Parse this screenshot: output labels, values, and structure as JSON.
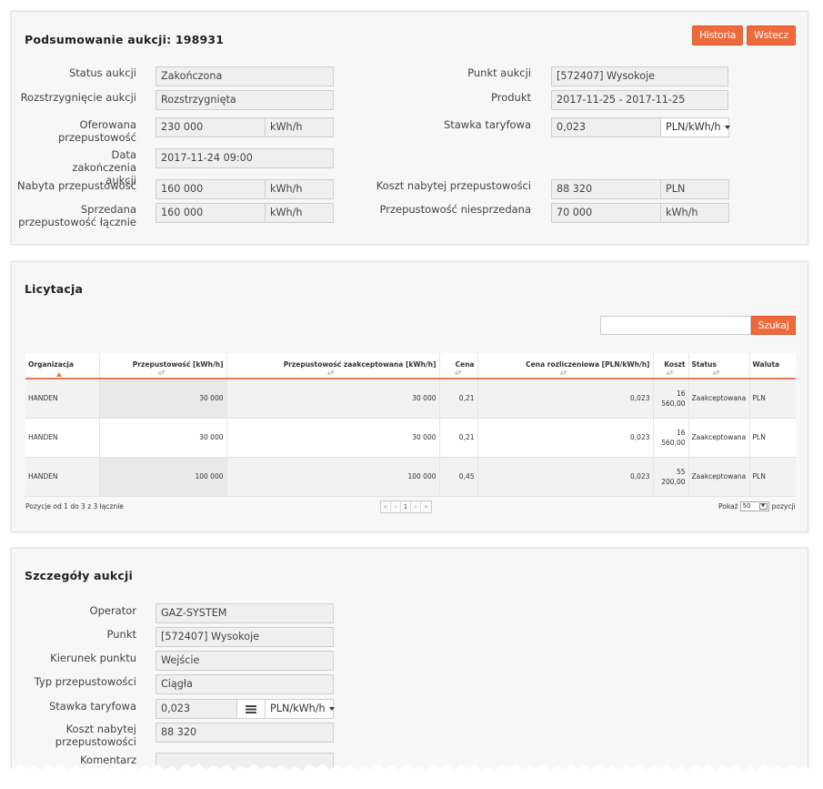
{
  "summary": {
    "title": "Podsumowanie aukcji: 198931",
    "buttons": {
      "history": "Historia",
      "back": "Wstecz"
    },
    "fields": {
      "status_label": "Status aukcji",
      "status_value": "Zakończona",
      "resolution_label": "Rozstrzygnięcie aukcji",
      "resolution_value": "Rozstrzygnięta",
      "offered_label": "Oferowana przepustowość",
      "offered_value": "230 000",
      "offered_unit": "kWh/h",
      "end_date_label": "Data zakończenia aukcji",
      "end_date_value": "2017-11-24 09:00",
      "acquired_label": "Nabyta przepustowość",
      "acquired_value": "160 000",
      "acquired_unit": "kWh/h",
      "sold_label": "Sprzedana przepustowość łącznie",
      "sold_value": "160 000",
      "sold_unit": "kWh/h",
      "point_label": "Punkt aukcji",
      "point_value": "[572407] Wysokoje",
      "product_label": "Produkt",
      "product_value": "2017-11-25 - 2017-11-25",
      "tariff_label": "Stawka taryfowa",
      "tariff_value": "0,023",
      "tariff_unit": "PLN/kWh/h",
      "cost_label": "Koszt nabytej przepustowości",
      "cost_value": "88 320",
      "cost_unit": "PLN",
      "unsold_label": "Przepustowość niesprzedana",
      "unsold_value": "70 000",
      "unsold_unit": "kWh/h"
    }
  },
  "bidding": {
    "title": "Licytacja",
    "search_button": "Szukaj",
    "search_placeholder": "",
    "columns": [
      "Organizacja",
      "Przepustowość [kWh/h]",
      "Przepustowość zaakceptowana [kWh/h]",
      "Cena",
      "Cena rozliczeniowa [PLN/kWh/h]",
      "Koszt",
      "Status",
      "Waluta"
    ],
    "rows": [
      {
        "org": "HANDEN",
        "capacity": "30 000",
        "accepted": "30 000",
        "price": "0,21",
        "settlement": "0,023",
        "cost_line1": "16",
        "cost_line2": "560,00",
        "status": "Zaakceptowana",
        "currency": "PLN"
      },
      {
        "org": "HANDEN",
        "capacity": "30 000",
        "accepted": "30 000",
        "price": "0,21",
        "settlement": "0,023",
        "cost_line1": "16",
        "cost_line2": "560,00",
        "status": "Zaakceptowana",
        "currency": "PLN"
      },
      {
        "org": "HANDEN",
        "capacity": "100 000",
        "accepted": "100 000",
        "price": "0,45",
        "settlement": "0,023",
        "cost_line1": "55",
        "cost_line2": "200,00",
        "status": "Zaakceptowana",
        "currency": "PLN"
      }
    ],
    "info": "Pozycje od 1 do 3 z 3 łącznie",
    "pager": {
      "first": "«",
      "prev": "‹",
      "page": "1",
      "next": "›",
      "last": "»"
    },
    "show_label": "Pokaż",
    "page_size": "50",
    "show_suffix": "pozycji"
  },
  "details": {
    "title": "Szczegóły aukcji",
    "operator_label": "Operator",
    "operator_value": "GAZ-SYSTEM",
    "point_label": "Punkt",
    "point_value": "[572407] Wysokoje",
    "direction_label": "Kierunek punktu",
    "direction_value": "Wejście",
    "capacity_type_label": "Typ przepustowości",
    "capacity_type_value": "Ciągła",
    "tariff_label": "Stawka taryfowa",
    "tariff_value": "0,023",
    "tariff_unit": "PLN/kWh/h",
    "cost_label": "Koszt nabytej przepustowości",
    "cost_value": "88 320",
    "comment_label": "Komentarz"
  },
  "colors": {
    "accent": "#ee6a3c",
    "panel_bg": "#f7f7f7",
    "field_bg": "#efefef"
  },
  "icons": {
    "list": "list-icon",
    "caret": "caret-down-icon",
    "sort_asc": "sort-asc-icon",
    "sort": "sort-icon"
  }
}
